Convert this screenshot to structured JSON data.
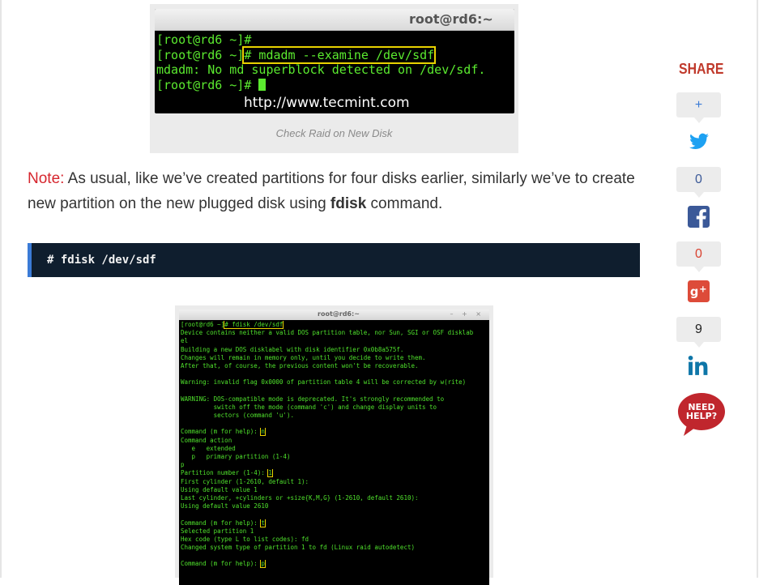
{
  "figure1": {
    "terminal_title": "root@rd6:~",
    "lines": [
      {
        "prompt": "[root@rd6 ~]#",
        "cmd": ""
      },
      {
        "prompt": "[root@rd6 ~]",
        "cmd": "# mdadm --examine /dev/sdf"
      },
      {
        "prompt": "mdadm: No md superblock detected on /dev/sdf.",
        "cmd": ""
      },
      {
        "prompt": "[root@rd6 ~]# ",
        "cmd": ""
      }
    ],
    "watermark": "http://www.tecmint.com",
    "caption": "Check Raid on New Disk"
  },
  "note": {
    "label": "Note:",
    "text_before": " As usual, like we’ve created partitions for four disks earlier, similarly we’ve to create new partition on the new plugged disk using ",
    "keyword": "fdisk",
    "text_after": " command."
  },
  "code_block": {
    "command": "# fdisk /dev/sdf"
  },
  "figure2": {
    "terminal_title": "root@rd6:~",
    "window_controls": "– + ×",
    "lines": [
      [
        "[root@rd6 ~]",
        "# fdisk /dev/sdf",
        ""
      ],
      [
        "Device contains neither a valid DOS partition table, nor Sun, SGI or OSF disklab",
        "",
        ""
      ],
      [
        "el",
        "",
        ""
      ],
      [
        "Building a new DOS disklabel with disk identifier 0x0b8a575f.",
        "",
        ""
      ],
      [
        "Changes will remain in memory only, until you decide to write them.",
        "",
        ""
      ],
      [
        "After that, of course, the previous content won't be recoverable.",
        "",
        ""
      ],
      [
        "",
        "",
        ""
      ],
      [
        "Warning: invalid flag 0x0000 of partition table 4 will be corrected by w(rite)",
        "",
        ""
      ],
      [
        "",
        "",
        ""
      ],
      [
        "WARNING: DOS-compatible mode is deprecated. It's strongly recommended to",
        "",
        ""
      ],
      [
        "         switch off the mode (command 'c') and change display units to",
        "",
        ""
      ],
      [
        "         sectors (command 'u').",
        "",
        ""
      ],
      [
        "",
        "",
        ""
      ],
      [
        "Command (m for help): ",
        "n",
        ""
      ],
      [
        "Command action",
        "",
        ""
      ],
      [
        "   e   extended",
        "",
        ""
      ],
      [
        "   p   primary partition (1-4)",
        "",
        ""
      ],
      [
        "p",
        "",
        ""
      ],
      [
        "Partition number (1-4): ",
        "1",
        ""
      ],
      [
        "First cylinder (1-2610, default 1):",
        "",
        ""
      ],
      [
        "Using default value 1",
        "",
        ""
      ],
      [
        "Last cylinder, +cylinders or +size{K,M,G} (1-2610, default 2610):",
        "",
        ""
      ],
      [
        "Using default value 2610",
        "",
        ""
      ],
      [
        "",
        "",
        ""
      ],
      [
        "Command (m for help): ",
        "t",
        ""
      ],
      [
        "Selected partition 1",
        "",
        ""
      ],
      [
        "Hex code (type L to list codes): fd",
        "",
        ""
      ],
      [
        "Changed system type of partition 1 to fd (Linux raid autodetect)",
        "",
        ""
      ],
      [
        "",
        "",
        ""
      ],
      [
        "Command (m for help): ",
        "p",
        ""
      ]
    ]
  },
  "share": {
    "title": "SHARE",
    "plus_label": "+",
    "twitter_count": "0",
    "facebook_count": "0",
    "googleplus_count": "9",
    "need_help_label": "NEED HELP?"
  },
  "colors": {
    "note_label": "#d6262e",
    "share_title": "#c0392b",
    "terminal_text": "#5bea2f",
    "code_bg": "#0f1e2e",
    "code_border": "#3b7bd6",
    "highlight_box": "#e8d200"
  }
}
